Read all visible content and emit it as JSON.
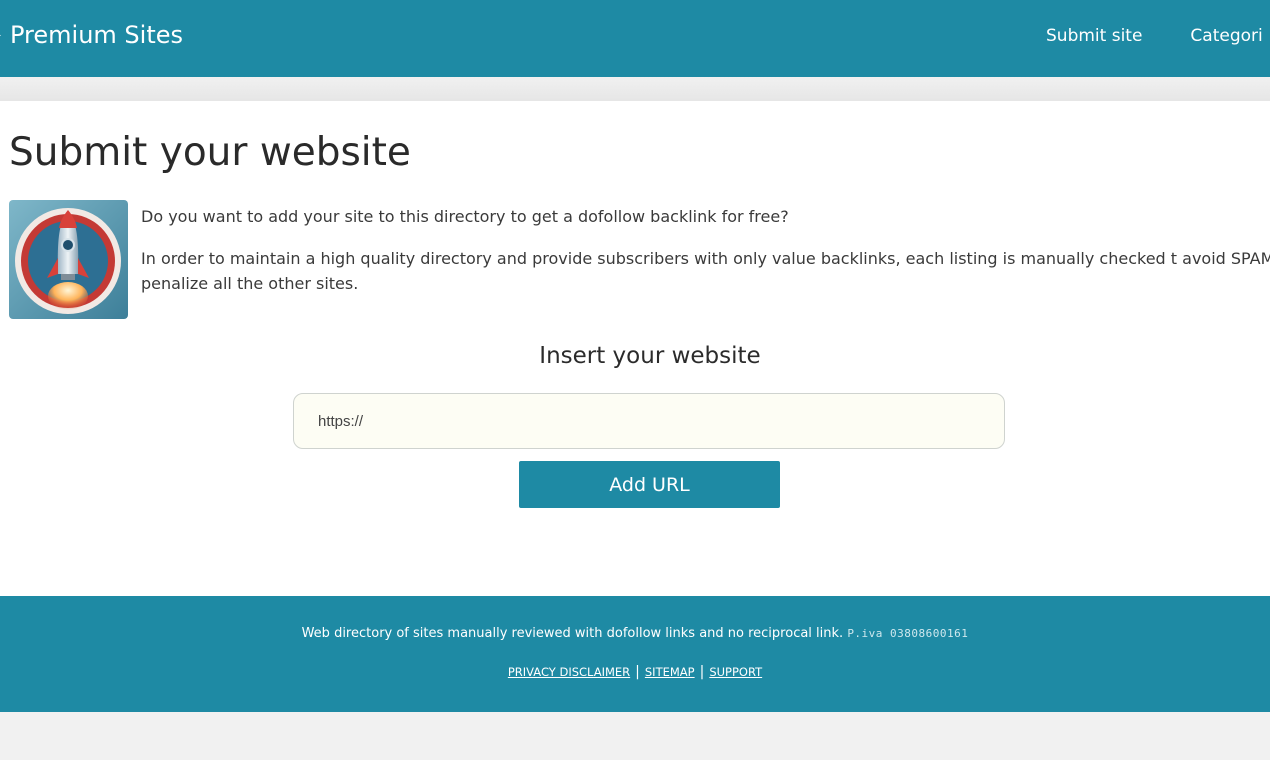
{
  "header": {
    "brand": "Premium Sites",
    "nav": [
      "Submit site",
      "Categori"
    ]
  },
  "main": {
    "title": "Submit your website",
    "intro_1": "Do you want to add your site to this directory to get a dofollow backlink for free?",
    "intro_2": "In order to maintain a high quality directory and provide subscribers with only value backlinks, each listing is manually checked t avoid SPAM and penalize all the other sites.",
    "image_icon": "rocket-icon"
  },
  "form": {
    "title": "Insert your website",
    "url_placeholder": "https://",
    "submit_label": "Add URL"
  },
  "footer": {
    "text": "Web directory of sites manually reviewed with dofollow links and no reciprocal link.",
    "piva": "P.iva 03808600161",
    "links": [
      "PRIVACY DISCLAIMER",
      "SITEMAP",
      "SUPPORT"
    ],
    "separator": "|"
  },
  "colors": {
    "accent": "#1e8aa4",
    "page_bg": "#f1f1f1",
    "input_bg": "#fdfdf4"
  }
}
